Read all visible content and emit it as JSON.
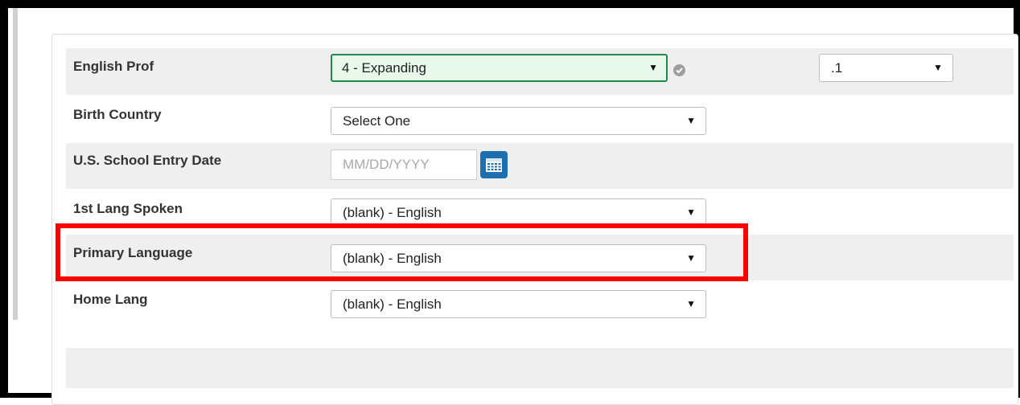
{
  "form": {
    "english_prof": {
      "label": "English Prof",
      "value": "4 - Expanding",
      "secondary_value": ".1"
    },
    "birth_country": {
      "label": "Birth Country",
      "value": "Select One"
    },
    "us_school_entry_date": {
      "label": "U.S. School Entry Date",
      "placeholder": "MM/DD/YYYY"
    },
    "first_lang_spoken": {
      "label": "1st Lang Spoken",
      "value": "(blank) - English"
    },
    "primary_language": {
      "label": "Primary Language",
      "value": "(blank) - English"
    },
    "home_lang": {
      "label": "Home Lang",
      "value": "(blank) - English"
    }
  },
  "icons": {
    "caret": "▼",
    "check": "check-circle-icon",
    "calendar": "calendar-icon"
  },
  "colors": {
    "active_field_bg": "#e8f8ea",
    "active_field_border": "#1f8a4c",
    "calendar_button": "#1d6fb0",
    "highlight": "#ff0000",
    "row_shade": "#efefef"
  }
}
